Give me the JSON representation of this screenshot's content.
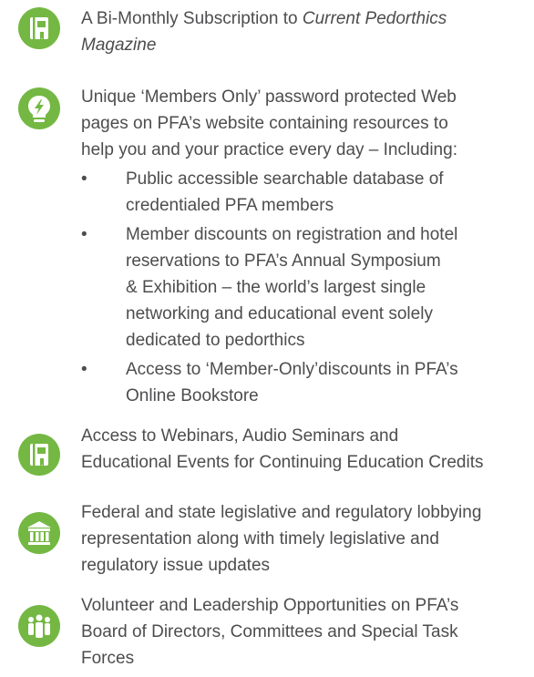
{
  "benefits": [
    {
      "icon": "book-icon",
      "text_prefix": "A Bi-Monthly Subscription to ",
      "text_italic": "Current Pedorthics\nMagazine"
    },
    {
      "icon": "lightbulb-icon",
      "text": "Unique ‘Members Only’ password protected Web\npages  on PFA’s website  containing resources to\nhelp you and your practice every day – Including:",
      "bullet_glyph": "•",
      "subitems": [
        "Public accessible searchable database of\ncredentialed PFA members",
        "Member discounts on registration and hotel\nreservations to PFA’s Annual Symposium\n& Exhibition – the world’s largest single\nnetworking and educational event solely\ndedicated to pedorthics",
        "Access to ‘Member-Only’discounts in PFA’s\nOnline Bookstore"
      ]
    },
    {
      "icon": "book-icon",
      "text": "Access to Webinars, Audio Seminars and\nEducational Events for Continuing Education Credits"
    },
    {
      "icon": "capitol-building-icon",
      "text": "Federal and state legislative and regulatory lobbying\nrepresentation along with timely legislative and\nregulatory issue updates"
    },
    {
      "icon": "people-group-icon",
      "text": "Volunteer and Leadership Opportunities on PFA’s\nBoard of Directors, Committees and Special Task\nForces"
    }
  ],
  "colors": {
    "icon_green": "#74b843",
    "text_gray": "#4d4d4f"
  }
}
